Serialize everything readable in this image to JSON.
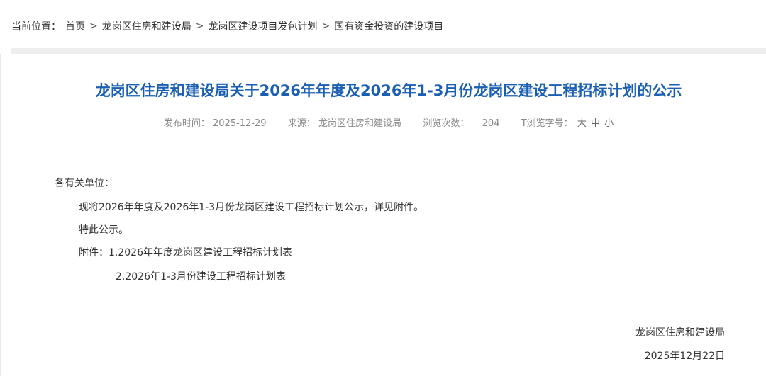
{
  "breadcrumb": {
    "lead": "当前位置：",
    "items": [
      "首页",
      "龙岗区住房和建设局",
      "龙岗区建设项目发包计划",
      "国有资金投资的建设项目"
    ],
    "separator": ">"
  },
  "article": {
    "title": "龙岗区住房和建设局关于2026年年度及2026年1-3月份龙岗区建设工程招标计划的公示",
    "meta": {
      "publish_label": "发布时间：",
      "publish_date": "2025-12-29",
      "source_label": "来源：",
      "source": "龙岗区住房和建设局",
      "views_label": "浏览次数：",
      "views": "204",
      "fontsize_label": "T浏览字号：",
      "font_large": "大",
      "font_medium": "中",
      "font_small": "小"
    },
    "body": {
      "salutation": "各有关单位：",
      "para1": "现将2026年年度及2026年1-3月份龙岗区建设工程招标计划公示，详见附件。",
      "para2": "特此公示。",
      "attach_label": "附件：",
      "attachment1": "1.2026年年度龙岗区建设工程招标计划表",
      "attachment2": "2.2026年1-3月份建设工程招标计划表"
    },
    "signature": {
      "org": "龙岗区住房和建设局",
      "date": "2025年12月22日"
    }
  },
  "colors": {
    "title": "#1a5fb4",
    "text": "#333333",
    "meta": "#888888",
    "bar": "#eeeeee"
  }
}
